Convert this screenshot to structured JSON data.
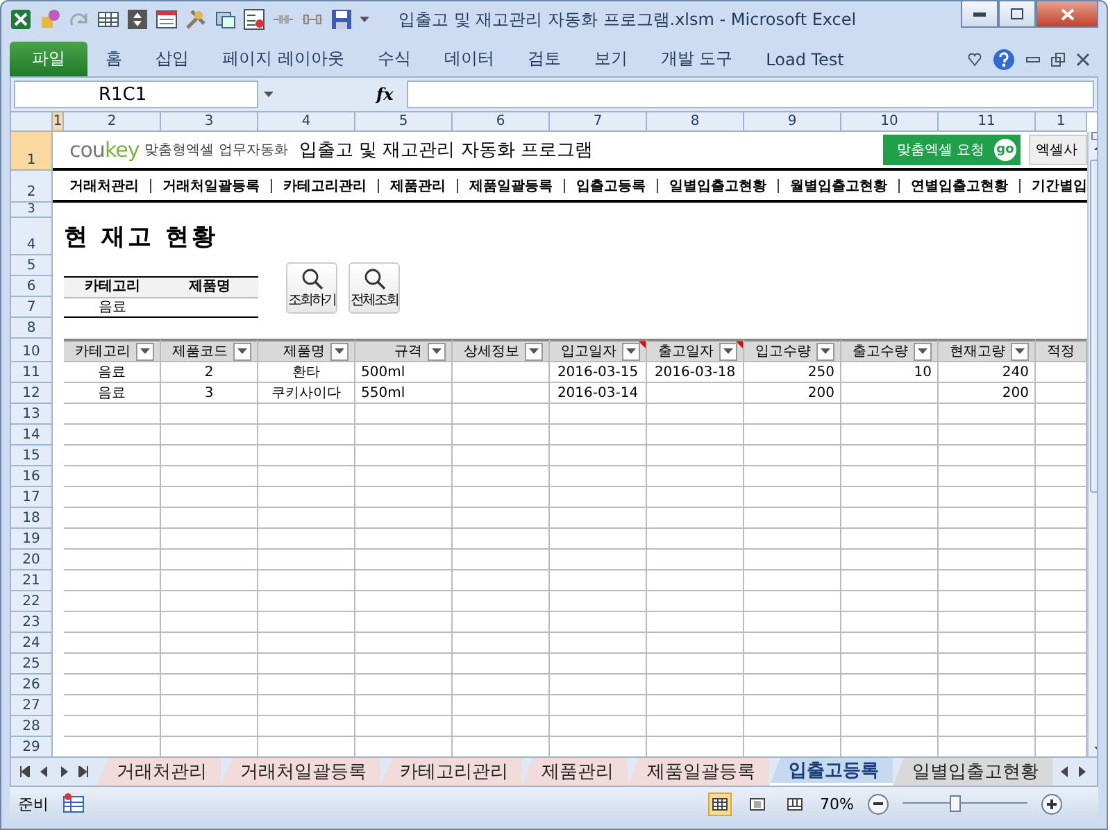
{
  "window": {
    "title": "입출고 및 재고관리 자동화 프로그램.xlsm  -  Microsoft Excel"
  },
  "ribbon_tabs": [
    {
      "label": "파일",
      "selected": true
    },
    {
      "label": "홈",
      "selected": false
    },
    {
      "label": "삽입",
      "selected": false
    },
    {
      "label": "페이지 레이아웃",
      "selected": false
    },
    {
      "label": "수식",
      "selected": false
    },
    {
      "label": "데이터",
      "selected": false
    },
    {
      "label": "검토",
      "selected": false
    },
    {
      "label": "보기",
      "selected": false
    },
    {
      "label": "개발 도구",
      "selected": false
    },
    {
      "label": "Load Test",
      "selected": false
    }
  ],
  "formula_bar": {
    "name_box": "R1C1",
    "fx": "fx"
  },
  "column_headers": [
    {
      "label": "1",
      "selected": true
    },
    {
      "label": "2",
      "selected": false
    },
    {
      "label": "3",
      "selected": false
    },
    {
      "label": "4",
      "selected": false
    },
    {
      "label": "5",
      "selected": false
    },
    {
      "label": "6",
      "selected": false
    },
    {
      "label": "7",
      "selected": false
    },
    {
      "label": "8",
      "selected": false
    },
    {
      "label": "9",
      "selected": false
    },
    {
      "label": "10",
      "selected": false
    },
    {
      "label": "11",
      "selected": false
    },
    {
      "label": "1",
      "selected": false
    }
  ],
  "row_headers": [
    {
      "label": "1",
      "selected": true
    },
    {
      "label": "2",
      "selected": false
    },
    {
      "label": "3",
      "selected": false
    },
    {
      "label": "4",
      "selected": false
    },
    {
      "label": "5",
      "selected": false
    },
    {
      "label": "6",
      "selected": false
    },
    {
      "label": "7",
      "selected": false
    },
    {
      "label": "8",
      "selected": false
    },
    {
      "label": "10",
      "selected": false
    },
    {
      "label": "11",
      "selected": false
    },
    {
      "label": "12",
      "selected": false
    },
    {
      "label": "13",
      "selected": false
    },
    {
      "label": "14",
      "selected": false
    },
    {
      "label": "15",
      "selected": false
    },
    {
      "label": "16",
      "selected": false
    },
    {
      "label": "17",
      "selected": false
    },
    {
      "label": "18",
      "selected": false
    },
    {
      "label": "19",
      "selected": false
    },
    {
      "label": "20",
      "selected": false
    },
    {
      "label": "21",
      "selected": false
    },
    {
      "label": "22",
      "selected": false
    },
    {
      "label": "23",
      "selected": false
    },
    {
      "label": "24",
      "selected": false
    },
    {
      "label": "25",
      "selected": false
    },
    {
      "label": "26",
      "selected": false
    },
    {
      "label": "27",
      "selected": false
    },
    {
      "label": "28",
      "selected": false
    },
    {
      "label": "29",
      "selected": false
    }
  ],
  "banner": {
    "logo_start": "cou",
    "logo_end": "key",
    "tagline": "맞춤형엑셀 업무자동화",
    "title": "입출고 및 재고관리 자동화 프로그램",
    "request_button": "맞춤엑셀 요청",
    "go_badge": "go",
    "usage_button": "엑셀사"
  },
  "nav": [
    "거래처관리",
    "거래처일괄등록",
    "카테고리관리",
    "제품관리",
    "제품일괄등록",
    "입출고등록",
    "일별입출고현황",
    "월별입출고현황",
    "연별입출고현황",
    "기간별입"
  ],
  "page_title": "현 재고 현황",
  "search": {
    "labels": [
      "카테고리",
      "제품명"
    ],
    "category_value": "음료",
    "buttons": [
      "조회하기",
      "전체조회"
    ]
  },
  "table": {
    "columns": [
      {
        "label": "카테고리",
        "comment": false
      },
      {
        "label": "제품코드",
        "comment": false
      },
      {
        "label": "제품명",
        "comment": false
      },
      {
        "label": "규격",
        "comment": false
      },
      {
        "label": "상세정보",
        "comment": false
      },
      {
        "label": "입고일자",
        "comment": true
      },
      {
        "label": "출고일자",
        "comment": true
      },
      {
        "label": "입고수량",
        "comment": false
      },
      {
        "label": "출고수량",
        "comment": false
      },
      {
        "label": "현재고량",
        "comment": false
      },
      {
        "label": "적정",
        "comment": false
      }
    ],
    "rows": [
      [
        "음료",
        "2",
        "환타",
        "500ml",
        null,
        "2016-03-15",
        "2016-03-18",
        "250",
        "10",
        "240",
        null
      ],
      [
        "음료",
        "3",
        "쿠키사이다",
        "550ml",
        null,
        "2016-03-14",
        null,
        "200",
        null,
        "200",
        null
      ]
    ]
  },
  "sheet_tabs": [
    {
      "label": "거래처관리",
      "selected": false,
      "color": "#f2dcdb"
    },
    {
      "label": "거래처일괄등록",
      "selected": false,
      "color": "#f2dcdb"
    },
    {
      "label": "카테고리관리",
      "selected": false,
      "color": "#f2dcdb"
    },
    {
      "label": "제품관리",
      "selected": false,
      "color": "#f2dcdb"
    },
    {
      "label": "제품일괄등록",
      "selected": false,
      "color": "#f2dcdb"
    },
    {
      "label": "입출고등록",
      "selected": true,
      "color": "#c6d9f1"
    },
    {
      "label": "일별입출고현황",
      "selected": false,
      "color": "#d9d9d9"
    }
  ],
  "status_bar": {
    "ready": "준비",
    "zoom": "70%",
    "zoom_slider": {
      "level": 0.42
    }
  }
}
